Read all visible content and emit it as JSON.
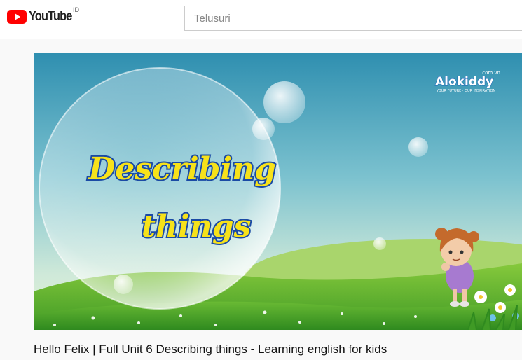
{
  "header": {
    "logo_text": "YouTube",
    "country_code": "ID",
    "search": {
      "placeholder": "Telusuri",
      "value": ""
    }
  },
  "video": {
    "thumbnail_title_line1": "Describing",
    "thumbnail_title_line2": "things",
    "channel_watermark": "Alokiddy",
    "watermark_tagline": "YOUR FUTURE · OUR INSPIRATION",
    "watermark_domain": "com.vn",
    "title": "Hello Felix | Full Unit 6 Describing things - Learning english for kids"
  },
  "colors": {
    "brand_red": "#ff0000",
    "sky_top": "#2f8fb0",
    "sky_bottom": "#d6ecd8",
    "grass": "#5ab532",
    "thumb_title_fill": "#f7e21a",
    "thumb_title_stroke": "#1a4aa5"
  }
}
